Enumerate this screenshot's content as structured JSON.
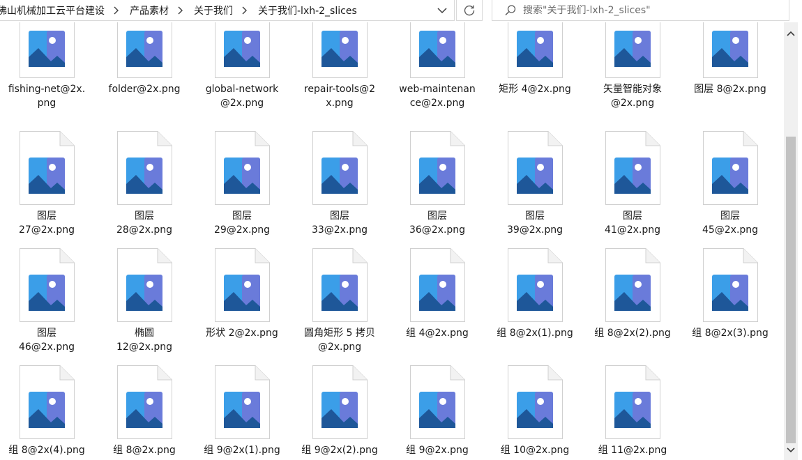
{
  "breadcrumb": {
    "items": [
      "佛山机械加工云平台建设",
      "产品素材",
      "关于我们",
      "关于我们-lxh-2_slices"
    ]
  },
  "search": {
    "placeholder": "搜索\"关于我们-lxh-2_slices\""
  },
  "icons": {
    "file": "image-file-icon",
    "chevron_separator": "chevron-right-icon",
    "dropdown": "chevron-down-icon",
    "refresh": "refresh-icon",
    "search": "search-icon",
    "scroll_up": "scroll-up-arrow-icon",
    "scroll_down": "scroll-down-arrow-icon"
  },
  "colors": {
    "image_blue_dark": "#1e5799",
    "image_blue_light": "#3b9ee8",
    "image_purple": "#7b6fd6",
    "page_fold": "#f2f2f2"
  },
  "files": [
    {
      "line1": "fishing-net@2x.",
      "line2": "png"
    },
    {
      "line1": "folder@2x.png",
      "line2": ""
    },
    {
      "line1": "global-network",
      "line2": "@2x.png"
    },
    {
      "line1": "repair-tools@2",
      "line2": "x.png"
    },
    {
      "line1": "web-maintenan",
      "line2": "ce@2x.png"
    },
    {
      "line1": "矩形 4@2x.png",
      "line2": ""
    },
    {
      "line1": "矢量智能对象",
      "line2": "@2x.png"
    },
    {
      "line1": "图层 8@2x.png",
      "line2": ""
    },
    {
      "line1": "图层",
      "line2": "27@2x.png"
    },
    {
      "line1": "图层",
      "line2": "28@2x.png"
    },
    {
      "line1": "图层",
      "line2": "29@2x.png"
    },
    {
      "line1": "图层",
      "line2": "33@2x.png"
    },
    {
      "line1": "图层",
      "line2": "36@2x.png"
    },
    {
      "line1": "图层",
      "line2": "39@2x.png"
    },
    {
      "line1": "图层",
      "line2": "41@2x.png"
    },
    {
      "line1": "图层",
      "line2": "45@2x.png"
    },
    {
      "line1": "图层",
      "line2": "46@2x.png"
    },
    {
      "line1": "椭圆",
      "line2": "12@2x.png"
    },
    {
      "line1": "形状 2@2x.png",
      "line2": ""
    },
    {
      "line1": "圆角矩形 5 拷贝",
      "line2": "@2x.png"
    },
    {
      "line1": "组 4@2x.png",
      "line2": ""
    },
    {
      "line1": "组 8@2x(1).png",
      "line2": ""
    },
    {
      "line1": "组 8@2x(2).png",
      "line2": ""
    },
    {
      "line1": "组 8@2x(3).png",
      "line2": ""
    },
    {
      "line1": "组 8@2x(4).png",
      "line2": ""
    },
    {
      "line1": "组 8@2x.png",
      "line2": ""
    },
    {
      "line1": "组 9@2x(1).png",
      "line2": ""
    },
    {
      "line1": "组 9@2x(2).png",
      "line2": ""
    },
    {
      "line1": "组 9@2x.png",
      "line2": ""
    },
    {
      "line1": "组 10@2x.png",
      "line2": ""
    },
    {
      "line1": "组 11@2x.png",
      "line2": ""
    }
  ]
}
